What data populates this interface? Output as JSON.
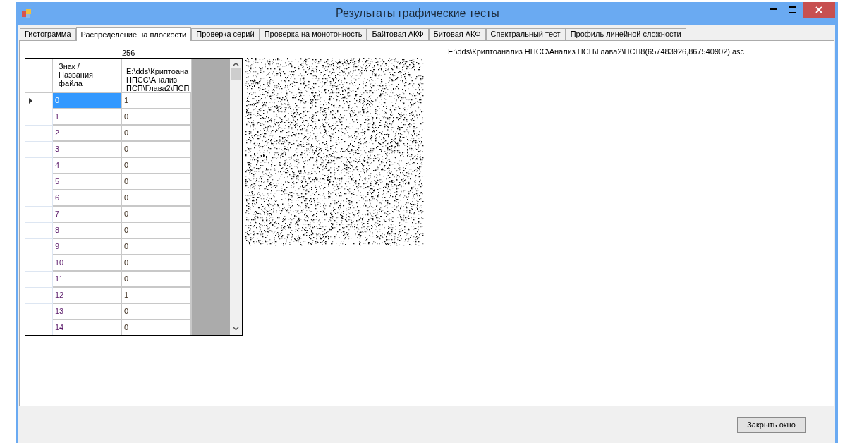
{
  "window": {
    "title": "Результаты графические тесты"
  },
  "tabs": [
    {
      "label": "Гистограмма",
      "selected": false
    },
    {
      "label": "Распределение на плоскости",
      "selected": true
    },
    {
      "label": "Проверка серий",
      "selected": false
    },
    {
      "label": "Проверка на монотонность",
      "selected": false
    },
    {
      "label": "Байтовая АКФ",
      "selected": false
    },
    {
      "label": "Битовая АКФ",
      "selected": false
    },
    {
      "label": "Спектральный тест",
      "selected": false
    },
    {
      "label": "Профиль линейной сложности",
      "selected": false
    }
  ],
  "size_label": "256",
  "file_path": "E:\\dds\\Криптоанализ НПСС\\Анализ ПСП\\Глава2\\ПСП8(657483926,867540902).asc",
  "table": {
    "columns": [
      "Знак / Названия файла",
      "E:\\dds\\Криптоана НПСС\\Анализ ПСП\\Глава2\\ПСП"
    ],
    "rows": [
      {
        "cells": [
          "0",
          "1"
        ],
        "selected": true
      },
      {
        "cells": [
          "1",
          "0"
        ],
        "selected": false
      },
      {
        "cells": [
          "2",
          "0"
        ],
        "selected": false
      },
      {
        "cells": [
          "3",
          "0"
        ],
        "selected": false
      },
      {
        "cells": [
          "4",
          "0"
        ],
        "selected": false
      },
      {
        "cells": [
          "5",
          "0"
        ],
        "selected": false
      },
      {
        "cells": [
          "6",
          "0"
        ],
        "selected": false
      },
      {
        "cells": [
          "7",
          "0"
        ],
        "selected": false
      },
      {
        "cells": [
          "8",
          "0"
        ],
        "selected": false
      },
      {
        "cells": [
          "9",
          "0"
        ],
        "selected": false
      },
      {
        "cells": [
          "10",
          "0"
        ],
        "selected": false
      },
      {
        "cells": [
          "11",
          "0"
        ],
        "selected": false
      },
      {
        "cells": [
          "12",
          "1"
        ],
        "selected": false
      },
      {
        "cells": [
          "13",
          "0"
        ],
        "selected": false
      },
      {
        "cells": [
          "14",
          "0"
        ],
        "selected": false
      }
    ]
  },
  "close_button": "Закрыть окно"
}
